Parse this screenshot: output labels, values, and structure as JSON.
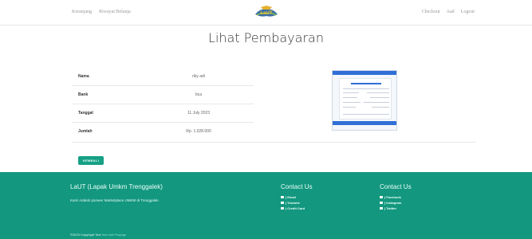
{
  "nav": {
    "left": [
      "Keranjang",
      "Riwayat Belanja"
    ],
    "right": [
      "Checkout",
      "Aad",
      "Logout"
    ],
    "logo_text": "LaUT"
  },
  "page": {
    "title": "Lihat Pembayaran"
  },
  "payment": {
    "rows": [
      {
        "label": "Nama",
        "value": "riky adi"
      },
      {
        "label": "Bank",
        "value": "bca"
      },
      {
        "label": "Tanggal",
        "value": "11 July 2023"
      },
      {
        "label": "Jumlah",
        "value": "Rp. 1.028.000"
      }
    ]
  },
  "actions": {
    "back_label": "KEMBALI"
  },
  "footer": {
    "brand": "LaUT (Lapak Umkm Trenggalek)",
    "description": "Kami Adalah pioneer Marketplace UMKM di Trenggalek.",
    "contact1": {
      "title": "Contact Us",
      "items": [
        "| Email",
        "| Youtube",
        "| Credit Card"
      ]
    },
    "contact2": {
      "title": "Contact Us",
      "items": [
        "| Facebook",
        "| Instagram",
        "| Twitter"
      ]
    },
    "copyright": "©2023 Copyright Text",
    "copyright_by": "from Adi Prayogo"
  }
}
